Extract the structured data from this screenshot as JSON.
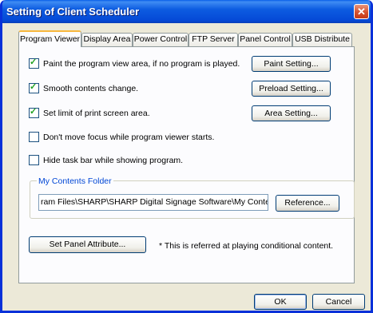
{
  "window": {
    "title": "Setting of Client Scheduler",
    "close_glyph": "✕"
  },
  "tabs": [
    {
      "label": "Program Viewer",
      "active": true
    },
    {
      "label": "Display Area"
    },
    {
      "label": "Power Control"
    },
    {
      "label": "FTP Server"
    },
    {
      "label": "Panel Control"
    },
    {
      "label": "USB Distribute"
    }
  ],
  "options": [
    {
      "label": "Paint the program view area, if no program is played.",
      "checked": true
    },
    {
      "label": "Smooth contents change.",
      "checked": true
    },
    {
      "label": "Set limit of print screen area.",
      "checked": true
    },
    {
      "label": "Don't move focus while program viewer starts.",
      "checked": false
    },
    {
      "label": "Hide task bar while showing program.",
      "checked": false
    }
  ],
  "side_buttons": [
    "Paint Setting...",
    "Preload Setting...",
    "Area Setting..."
  ],
  "contents_folder": {
    "legend": "My Contents Folder",
    "path": "ram Files\\SHARP\\SHARP Digital Signage Software\\My Contents",
    "reference_label": "Reference..."
  },
  "set_panel_label": "Set Panel Attribute...",
  "note": "* This is referred at playing conditional content.",
  "footer": {
    "ok_label": "OK",
    "cancel_label": "Cancel"
  },
  "colors": {
    "titlebar": "#0a5fe8",
    "group_legend": "#0046d5",
    "active_tab_accent": "#f8b73e",
    "check": "#21a121"
  }
}
